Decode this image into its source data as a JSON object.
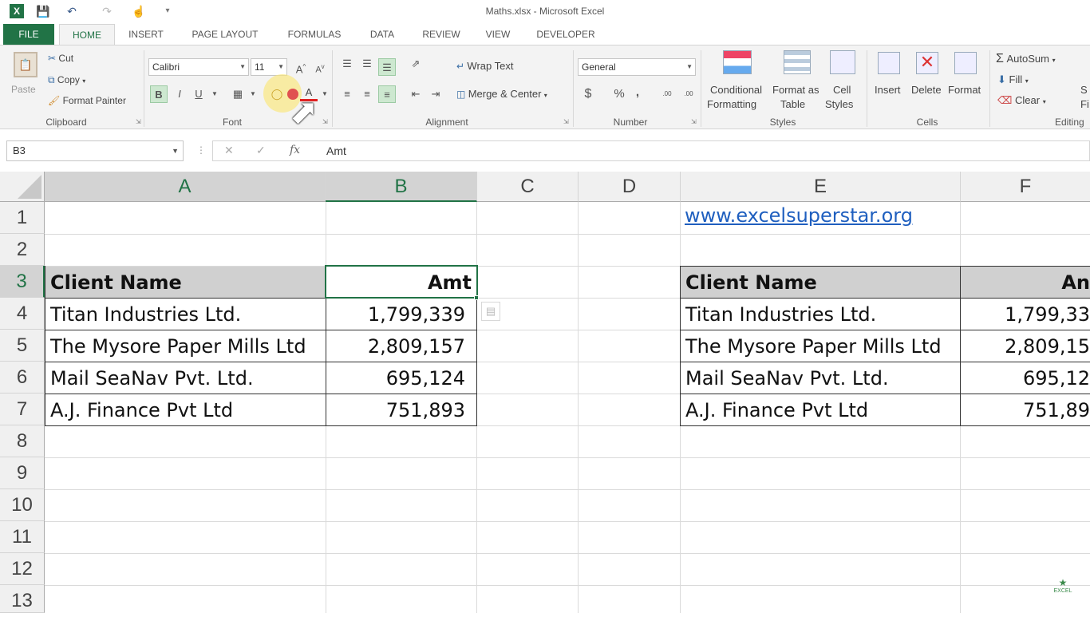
{
  "window": {
    "title": "Maths.xlsx - Microsoft Excel"
  },
  "tabs": [
    "FILE",
    "HOME",
    "INSERT",
    "PAGE LAYOUT",
    "FORMULAS",
    "DATA",
    "REVIEW",
    "VIEW",
    "DEVELOPER"
  ],
  "ribbon": {
    "clipboard": {
      "paste": "Paste",
      "cut": "Cut",
      "copy": "Copy",
      "format_painter": "Format Painter",
      "label": "Clipboard"
    },
    "font": {
      "name": "Calibri",
      "size": "11",
      "bold": "B",
      "italic": "I",
      "underline": "U",
      "label": "Font"
    },
    "alignment": {
      "wrap_text": "Wrap Text",
      "merge_center": "Merge & Center",
      "label": "Alignment"
    },
    "number": {
      "format": "General",
      "currency": "$",
      "percent": "%",
      "comma": ",",
      "inc_dec": ".00",
      "label": "Number"
    },
    "styles": {
      "conditional": "Conditional",
      "conditional2": "Formatting",
      "format_as": "Format as",
      "format_as2": "Table",
      "cell": "Cell",
      "cell2": "Styles",
      "label": "Styles"
    },
    "cells": {
      "insert": "Insert",
      "delete": "Delete",
      "format": "Format",
      "label": "Cells"
    },
    "editing": {
      "autosum": "AutoSum",
      "fill": "Fill",
      "clear": "Clear",
      "label": "Editing",
      "sort1": "S",
      "sort2": "Fi"
    }
  },
  "formula_bar": {
    "name_box": "B3",
    "fx": "fx",
    "value": "Amt"
  },
  "columns": [
    "A",
    "B",
    "C",
    "D",
    "E",
    "F"
  ],
  "rows": [
    "1",
    "2",
    "3",
    "4",
    "5",
    "6",
    "7",
    "8",
    "9",
    "10",
    "11",
    "12",
    "13"
  ],
  "link": "www.excelsuperstar.org",
  "table1": {
    "headers": [
      "Client Name",
      "Amt"
    ],
    "rows": [
      [
        "Titan Industries Ltd.",
        "1,799,339"
      ],
      [
        "The Mysore Paper Mills Ltd",
        "2,809,157"
      ],
      [
        "Mail SeaNav Pvt. Ltd.",
        "695,124"
      ],
      [
        "A.J. Finance Pvt Ltd",
        "751,893"
      ]
    ]
  },
  "table2": {
    "headers": [
      "Client Name",
      "An"
    ],
    "rows": [
      [
        "Titan Industries Ltd.",
        "1,799,33"
      ],
      [
        "The Mysore Paper Mills Ltd",
        "2,809,15"
      ],
      [
        "Mail SeaNav Pvt. Ltd.",
        "695,12"
      ],
      [
        "A.J. Finance Pvt Ltd",
        "751,89"
      ]
    ]
  },
  "watermark": "EXCEL"
}
